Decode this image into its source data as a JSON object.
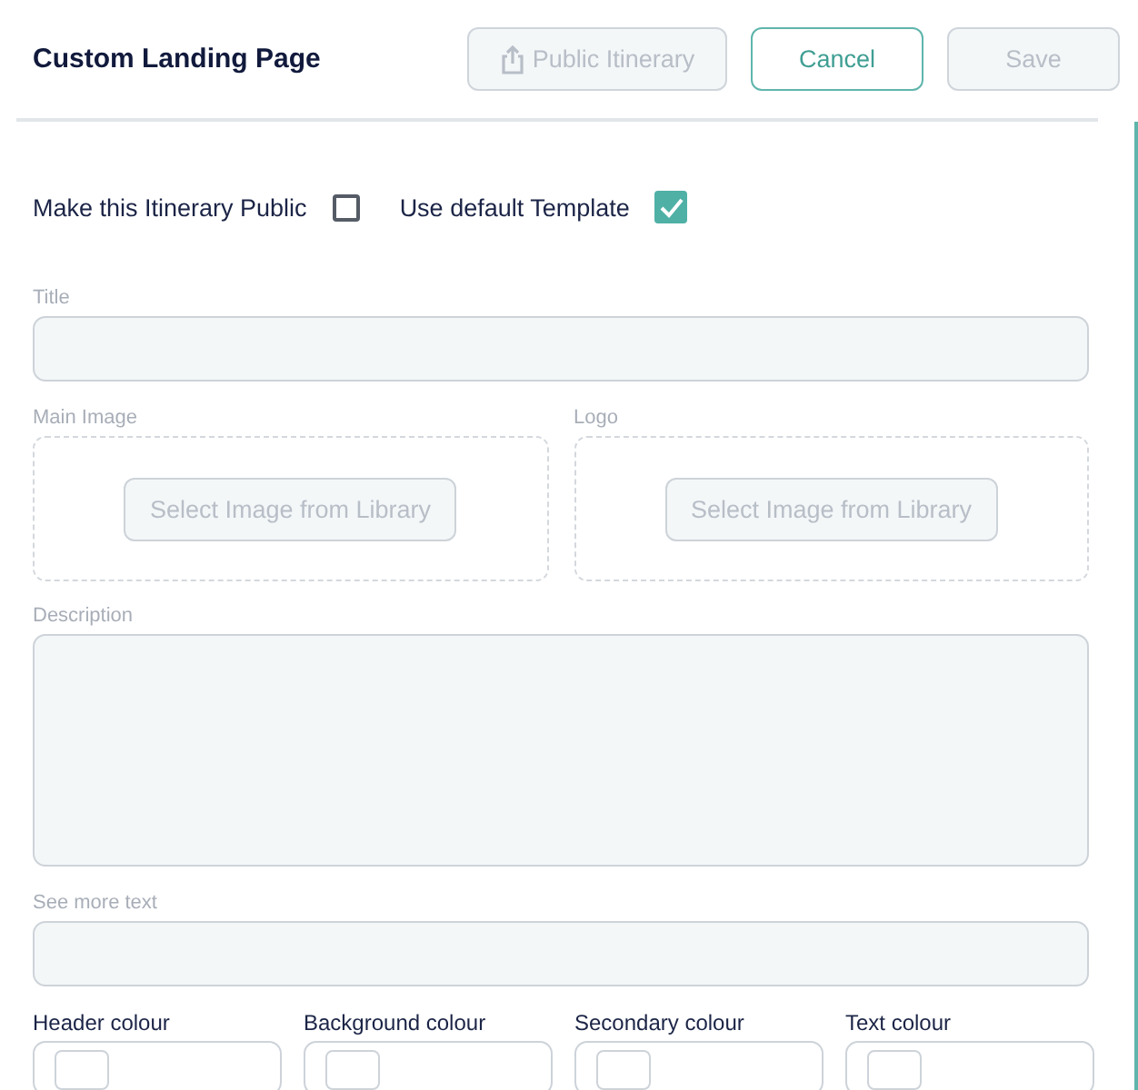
{
  "header": {
    "title": "Custom Landing Page",
    "buttons": [
      {
        "label": "Public Itinerary",
        "kind": "share",
        "disabled": true
      },
      {
        "label": "Cancel",
        "kind": "outline",
        "disabled": false
      },
      {
        "label": "Save",
        "kind": "plain",
        "disabled": true
      }
    ]
  },
  "options": [
    {
      "label": "Make this Itinerary Public",
      "checked": false
    },
    {
      "label": "Use default Template",
      "checked": true
    }
  ],
  "fields": [
    {
      "kind": "text",
      "label": "Title",
      "disabled": true
    },
    {
      "kind": "images",
      "items": [
        {
          "label": "Main Image",
          "button": "Select Image from Library",
          "disabled": true
        },
        {
          "label": "Logo",
          "button": "Select Image from Library",
          "disabled": true
        }
      ]
    },
    {
      "kind": "textarea",
      "label": "Description",
      "disabled": true
    },
    {
      "kind": "text",
      "label": "See more text",
      "disabled": true
    }
  ],
  "colours": [
    {
      "label": "Header colour"
    },
    {
      "label": "Background colour"
    },
    {
      "label": "Secondary colour"
    },
    {
      "label": "Text colour"
    }
  ]
}
